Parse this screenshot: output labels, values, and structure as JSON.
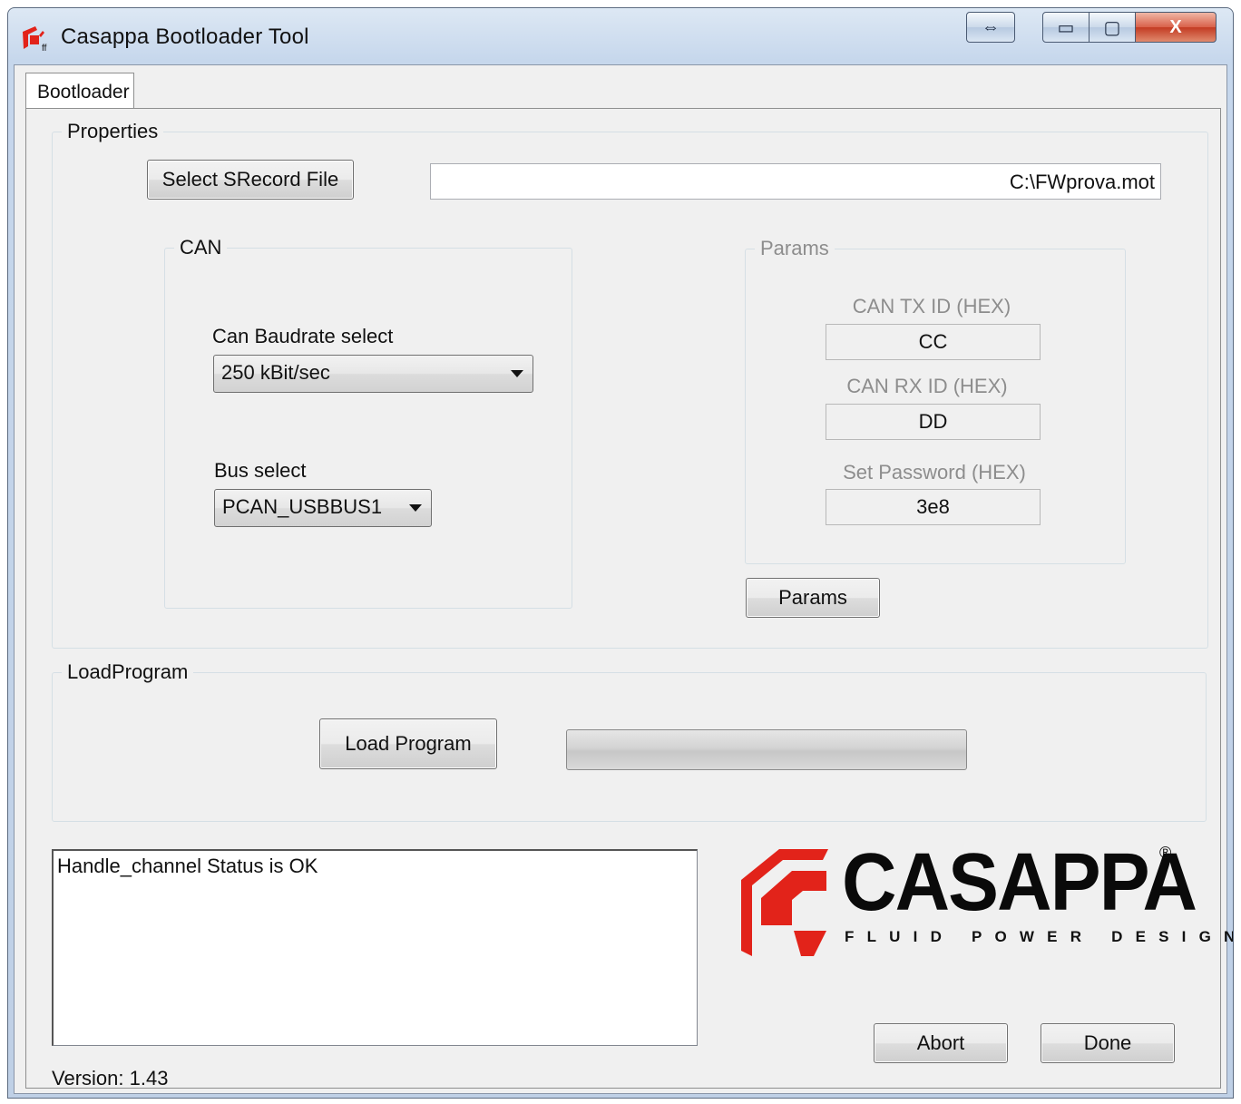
{
  "window": {
    "title": "Casappa Bootloader Tool",
    "buttons": {
      "move": "⇔",
      "minimize": "▭",
      "maximize": "▢",
      "close": "X"
    }
  },
  "tabs": [
    "Bootloader"
  ],
  "properties": {
    "group_label": "Properties",
    "select_file_label": "Select SRecord File",
    "file_path": "C:\\FWprova.mot"
  },
  "can": {
    "group_label": "CAN",
    "baudrate_label": "Can Baudrate select",
    "baudrate_value": "250 kBit/sec",
    "bus_label": "Bus select",
    "bus_value": "PCAN_USBBUS1"
  },
  "params": {
    "group_label": "Params",
    "tx_label": "CAN TX ID (HEX)",
    "tx_value": "CC",
    "rx_label": "CAN RX ID (HEX)",
    "rx_value": "DD",
    "password_label": "Set Password (HEX)",
    "password_value": "3e8",
    "button_label": "Params"
  },
  "load_program": {
    "group_label": "LoadProgram",
    "button_label": "Load Program",
    "progress": 0
  },
  "log": {
    "text": "Handle_channel Status is OK"
  },
  "logo": {
    "word": "CASAPPA",
    "registered": "®",
    "tagline": "FLUID POWER DESIGN",
    "brand_color": "#e2231a"
  },
  "actions": {
    "abort_label": "Abort",
    "done_label": "Done"
  },
  "version": "Version: 1.43"
}
